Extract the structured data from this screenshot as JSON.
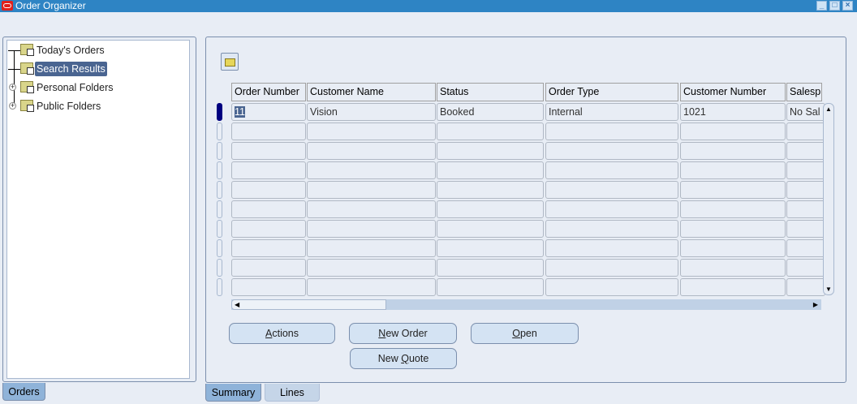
{
  "window": {
    "title": "Order Organizer",
    "minimize": "_",
    "maximize": "□",
    "close": "×"
  },
  "tree": {
    "items": [
      {
        "label": "Today's Orders",
        "icon": "search-folder-icon",
        "expandable": false,
        "selected": false
      },
      {
        "label": "Search Results",
        "icon": "results-folder-icon",
        "expandable": false,
        "selected": true
      },
      {
        "label": "Personal Folders",
        "icon": "person-folder-icon",
        "expandable": true,
        "selected": false
      },
      {
        "label": "Public Folders",
        "icon": "group-folder-icon",
        "expandable": true,
        "selected": false
      }
    ]
  },
  "left_tabs": [
    {
      "label": "Orders",
      "active": true
    }
  ],
  "grid": {
    "columns": [
      "Order Number",
      "Customer Name",
      "Status",
      "Order Type",
      "Customer Number",
      "Salesp"
    ],
    "rows": [
      [
        "11",
        "Vision",
        "Booked",
        "Internal",
        "1021",
        "No Sal"
      ],
      [
        "",
        "",
        "",
        "",
        "",
        ""
      ],
      [
        "",
        "",
        "",
        "",
        "",
        ""
      ],
      [
        "",
        "",
        "",
        "",
        "",
        ""
      ],
      [
        "",
        "",
        "",
        "",
        "",
        ""
      ],
      [
        "",
        "",
        "",
        "",
        "",
        ""
      ],
      [
        "",
        "",
        "",
        "",
        "",
        ""
      ],
      [
        "",
        "",
        "",
        "",
        "",
        ""
      ],
      [
        "",
        "",
        "",
        "",
        "",
        ""
      ],
      [
        "",
        "",
        "",
        "",
        "",
        ""
      ]
    ]
  },
  "buttons": {
    "actions": {
      "mn": "A",
      "rest": "ctions"
    },
    "new_order": {
      "mn": "N",
      "rest": "ew Order"
    },
    "open": {
      "mn": "O",
      "rest": "pen"
    },
    "new_quote": {
      "pre": "New ",
      "mn": "Q",
      "rest": "uote"
    }
  },
  "right_tabs": [
    {
      "label": "Summary",
      "active": true
    },
    {
      "label": "Lines",
      "active": false
    }
  ]
}
